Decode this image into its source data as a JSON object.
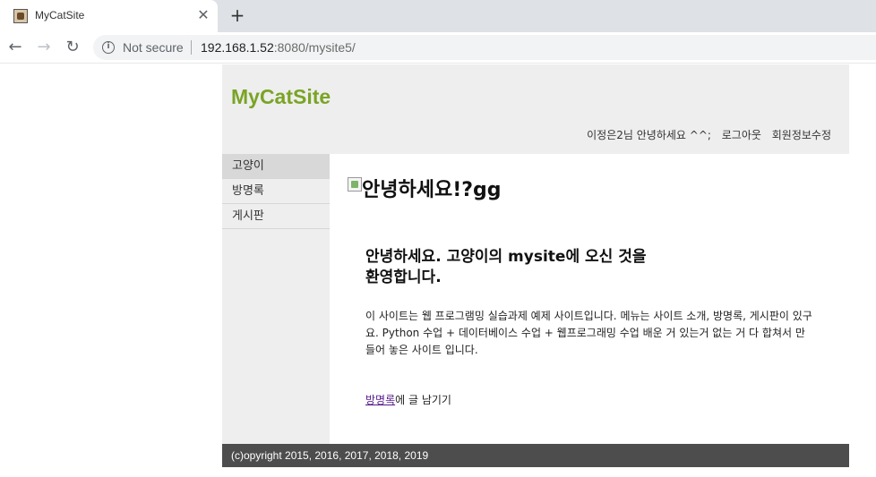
{
  "browser": {
    "tab_title": "MyCatSite",
    "close_glyph": "✕",
    "new_tab_glyph": "+",
    "back_glyph": "←",
    "forward_glyph": "→",
    "reload_glyph": "↻",
    "info_glyph": "i",
    "security_label": "Not secure",
    "url_host": "192.168.1.52",
    "url_rest": ":8080/mysite5/"
  },
  "site": {
    "logo": "MyCatSite",
    "member": {
      "greeting": "이정은2님 안녕하세요 ^^;",
      "logout": "로그아웃",
      "edit_profile": "회원정보수정"
    },
    "navigation": [
      {
        "label": "고양이",
        "active": true
      },
      {
        "label": "방명록",
        "active": false
      },
      {
        "label": "게시판",
        "active": false
      }
    ],
    "content": {
      "image_alt": "안녕하세요!?gg",
      "welcome_heading": "안녕하세요. 고양이의 mysite에 오신 것을 환영합니다.",
      "intro": "이 사이트는 웹 프로그램밍 실습과제 예제 사이트입니다. 메뉴는 사이트 소개, 방명록, 게시판이 있구요. Python 수업 + 데이터베이스 수업 + 웹프로그래밍 수업 배운 거 있는거 없는 거 다 합쳐서 만들어 놓은 사이트 입니다.",
      "guestbook_link": "방명록",
      "guestbook_suffix": "에 글 남기기"
    },
    "footer": "(c)opyright 2015, 2016, 2017, 2018, 2019"
  },
  "colors": {
    "logo": "#7aa425",
    "header_bg": "#eeeeee",
    "footer_bg": "#4d4d4d",
    "link_visited": "#551a8b"
  }
}
